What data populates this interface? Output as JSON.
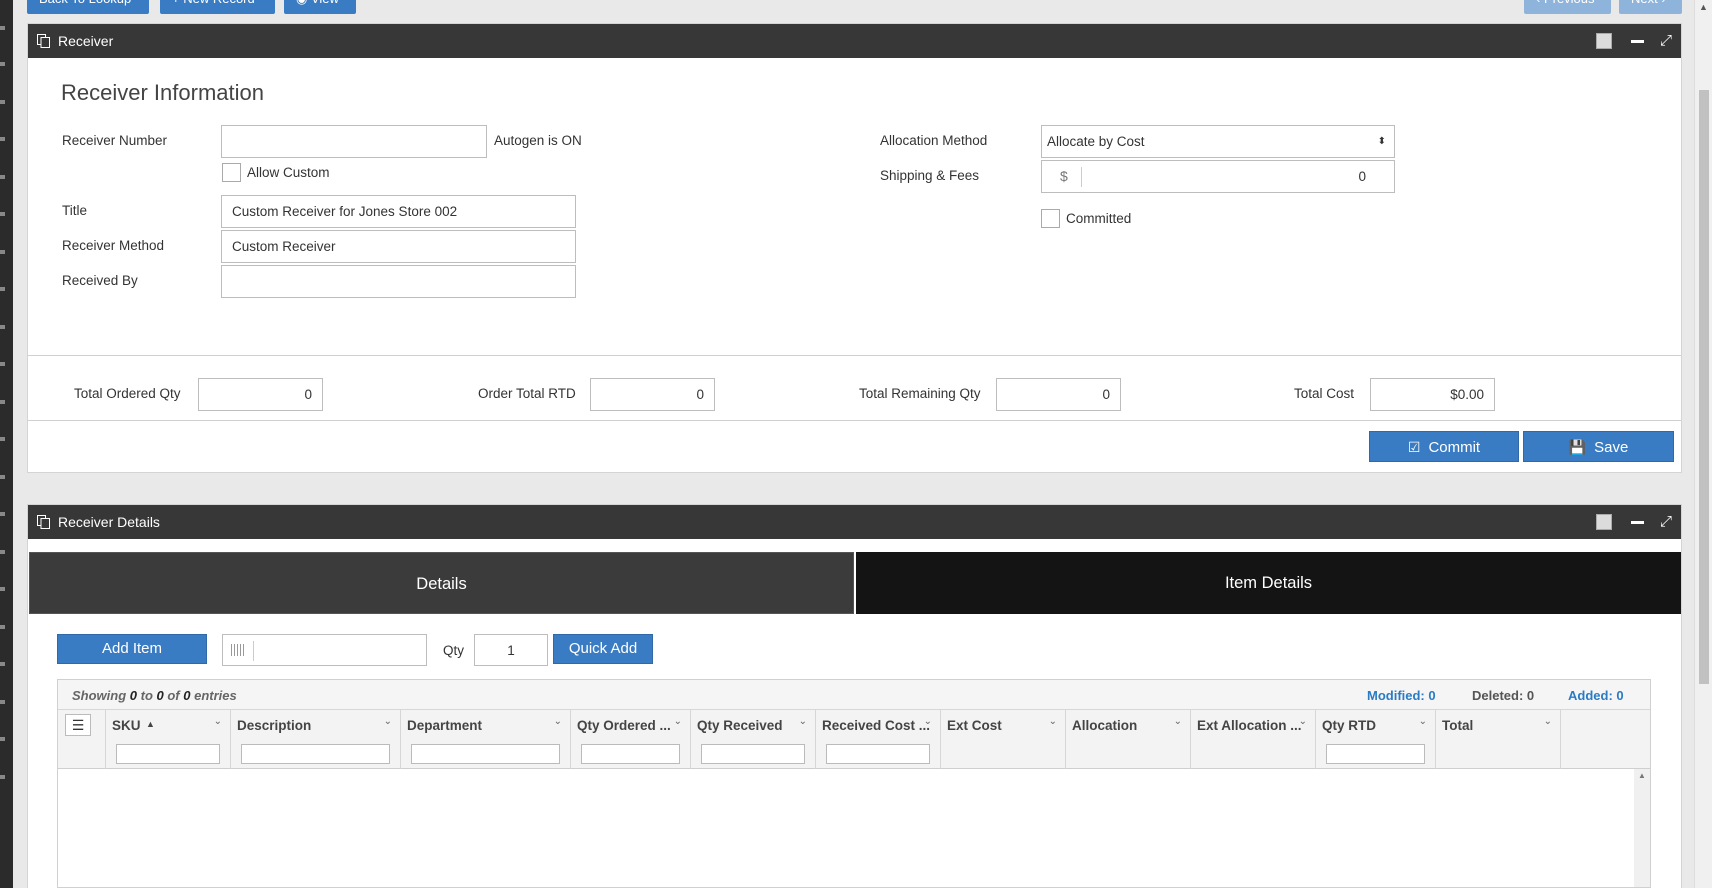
{
  "top_buttons": {
    "back": "Back To Lookup",
    "new_record": "+ New Record",
    "view": "◉ View",
    "previous": "‹ Previous",
    "next": "Next ›"
  },
  "receiver_panel": {
    "title": "Receiver",
    "section_title": "Receiver Information",
    "receiver_number_label": "Receiver Number",
    "receiver_number_value": "",
    "autogen_text": "Autogen is ON",
    "allow_custom_label": "Allow Custom",
    "title_label": "Title",
    "title_value": "Custom Receiver for Jones Store 002",
    "receiver_method_label": "Receiver Method",
    "receiver_method_value": "Custom Receiver",
    "received_by_label": "Received By",
    "received_by_value": "",
    "allocation_method_label": "Allocation Method",
    "allocation_method_value": "Allocate by Cost",
    "shipping_fees_label": "Shipping & Fees",
    "shipping_currency": "$",
    "shipping_value": "0",
    "committed_label": "Committed",
    "totals": {
      "total_ordered_qty_label": "Total Ordered Qty",
      "total_ordered_qty": "0",
      "order_total_rtd_label": "Order Total RTD",
      "order_total_rtd": "0",
      "total_remaining_qty_label": "Total Remaining Qty",
      "total_remaining_qty": "0",
      "total_cost_label": "Total Cost",
      "total_cost": "$0.00"
    },
    "commit_label": "Commit",
    "save_label": "Save"
  },
  "details_panel": {
    "title": "Receiver Details",
    "tabs": [
      "Details",
      "Item Details"
    ],
    "add_item_label": "Add Item",
    "qty_label": "Qty",
    "qty_value": "1",
    "quick_add_label": "Quick Add",
    "showing": {
      "prefix": "Showing ",
      "from": "0",
      "to_word": " to ",
      "to": "0",
      "of_word": " of ",
      "total": "0",
      "suffix": " entries"
    },
    "modified": "Modified: 0",
    "deleted": "Deleted: 0",
    "added": "Added: 0",
    "columns": [
      "SKU",
      "Description",
      "Department",
      "Qty Ordered ...",
      "Qty Received",
      "Received Cost ...",
      "Ext Cost",
      "Allocation",
      "Ext Allocation ...",
      "Qty RTD",
      "Total"
    ]
  },
  "colors": {
    "primary": "#3a7cc3",
    "panel_header": "#373737",
    "tab_active": "#141414",
    "tab_inactive": "#3b3b3b",
    "link": "#2a7bc4"
  }
}
